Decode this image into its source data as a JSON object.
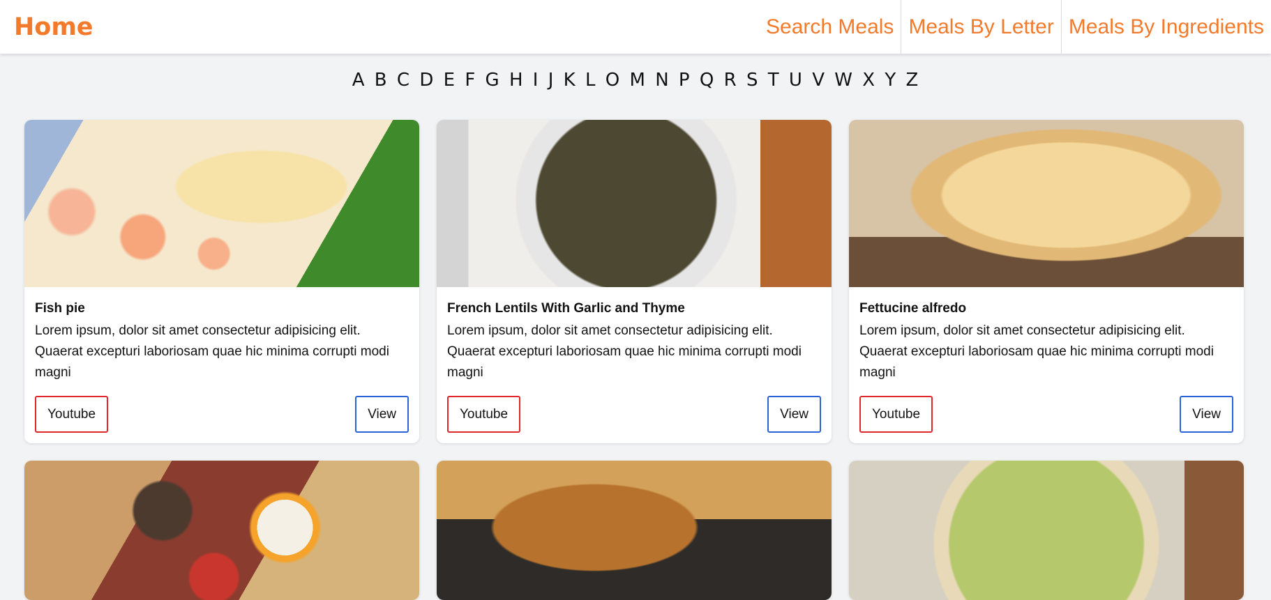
{
  "nav": {
    "home": "Home",
    "links": [
      "Search Meals",
      "Meals By Letter",
      "Meals By Ingredients"
    ]
  },
  "letters": [
    "A",
    "B",
    "C",
    "D",
    "E",
    "F",
    "G",
    "H",
    "I",
    "J",
    "K",
    "L",
    "O",
    "M",
    "N",
    "P",
    "Q",
    "R",
    "S",
    "T",
    "U",
    "V",
    "W",
    "X",
    "Y",
    "Z"
  ],
  "meals": [
    {
      "title": "Fish pie",
      "description": "Lorem ipsum, dolor sit amet consectetur adipisicing elit. Quaerat excepturi laboriosam quae hic minima corrupti modi magni",
      "youtube_label": "Youtube",
      "view_label": "View",
      "image": "fish-pie"
    },
    {
      "title": "French Lentils With Garlic and Thyme",
      "description": "Lorem ipsum, dolor sit amet consectetur adipisicing elit. Quaerat excepturi laboriosam quae hic minima corrupti modi magni",
      "youtube_label": "Youtube",
      "view_label": "View",
      "image": "lentils"
    },
    {
      "title": "Fettucine alfredo",
      "description": "Lorem ipsum, dolor sit amet consectetur adipisicing elit. Quaerat excepturi laboriosam quae hic minima corrupti modi magni",
      "youtube_label": "Youtube",
      "view_label": "View",
      "image": "alfredo"
    },
    {
      "image": "breakfast"
    },
    {
      "image": "onion-soup"
    },
    {
      "image": "leek-quiche"
    }
  ]
}
